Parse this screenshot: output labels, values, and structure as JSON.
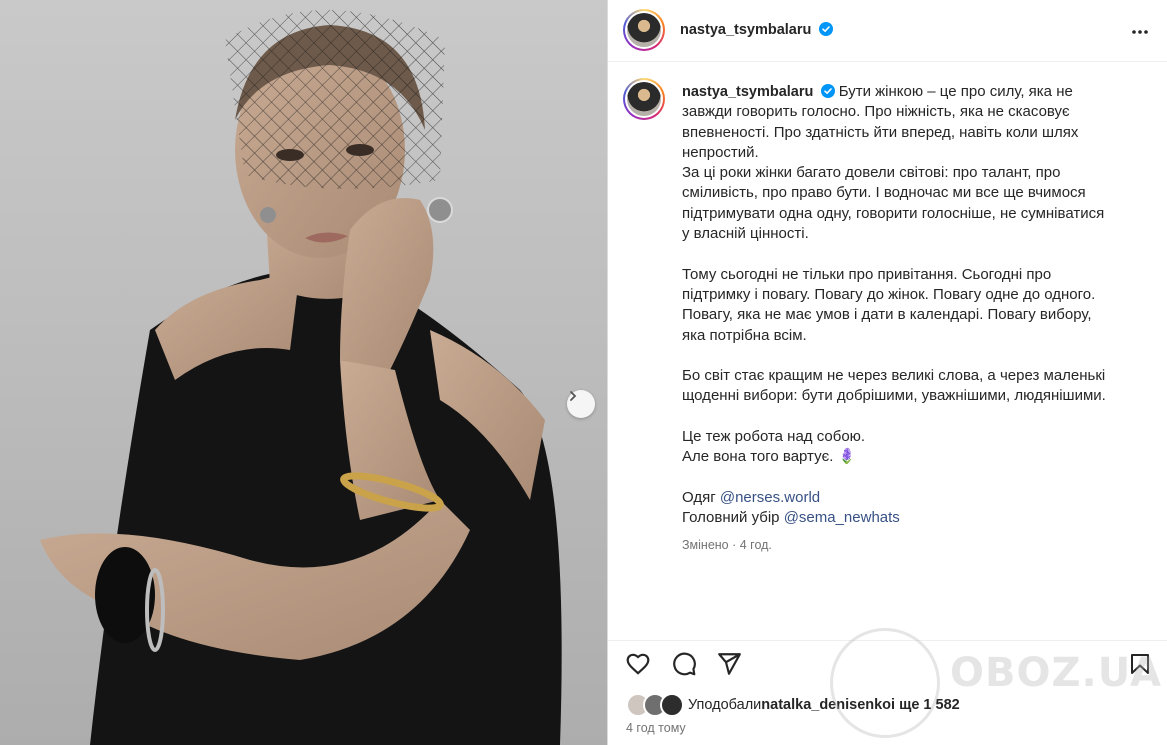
{
  "post": {
    "username": "nastya_tsymbalaru",
    "verified": true,
    "caption_lines": [
      "Бути жінкою – це про силу, яка не",
      "завжди говорить голосно. Про ніжність, яка не скасовує",
      "впевненості. Про здатність йти вперед, навіть коли шлях",
      "непростий.",
      "За ці роки жінки багато довели світові: про талант, про",
      "сміливість, про право бути. І водночас ми все ще вчимося",
      "підтримувати одна одну, говорити голосніше, не сумніватися",
      "у власній цінності.",
      "",
      "Тому сьогодні не тільки про привітання. Сьогодні про",
      "підтримку і повагу. Повагу до жінок. Повагу одне до одного.",
      "Повагу, яка не має умов і дати в календарі. Повагу вибору,",
      "яка потрібна всім.",
      "",
      "Бо світ стає кращим не через великі слова, а через маленькі",
      "щоденні вибори: бути добрішими, уважнішими, людянішими.",
      "",
      "Це теж робота над собою.",
      "Але вона того вартує. 🪻",
      ""
    ],
    "credits": [
      {
        "label": "Одяг ",
        "handle": "@nerses.world"
      },
      {
        "label": "Головний убір ",
        "handle": "@sema_newhats"
      }
    ],
    "edited_meta": "Змінено · 4 год.",
    "likes_prefix": "Уподобали ",
    "likes_user": "natalka_denisenko",
    "likes_suffix": " і ще 1 582",
    "time_ago": "4 год тому"
  },
  "icons": {
    "more": "more-horizontal-icon",
    "like": "heart-icon",
    "comment": "comment-icon",
    "share": "send-icon",
    "save": "bookmark-icon",
    "next": "chevron-right-icon"
  },
  "watermark": "OBOZ.UA",
  "colors": {
    "link": "#385185",
    "verified": "#0095f6",
    "text": "#262626",
    "muted": "#737373"
  }
}
